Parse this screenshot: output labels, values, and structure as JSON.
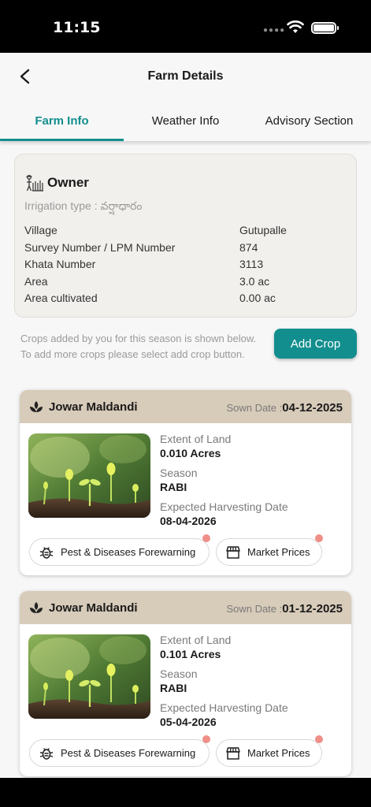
{
  "status_bar": {
    "time": "11:15"
  },
  "header": {
    "title": "Farm Details"
  },
  "tabs": [
    {
      "label": "Farm Info"
    },
    {
      "label": "Weather Info"
    },
    {
      "label": "Advisory Section"
    }
  ],
  "owner_card": {
    "name": "Owner",
    "irrigation_label": "Irrigation type :",
    "irrigation_value": "వర్షాధారం",
    "rows": [
      {
        "key": "Village",
        "value": "Gutupalle"
      },
      {
        "key": "Survey Number / LPM Number",
        "value": "874"
      },
      {
        "key": "Khata Number",
        "value": "3113"
      },
      {
        "key": "Area",
        "value": "3.0 ac"
      },
      {
        "key": "Area cultivated",
        "value": "0.00 ac"
      }
    ]
  },
  "note": "Crops added by you for this season is shown below. To add more crops please select add crop button.",
  "add_crop_label": "Add Crop",
  "colors": {
    "accent": "#128e8e",
    "card_header": "#d7cbb9",
    "dot": "#ef8f87"
  },
  "crops": [
    {
      "name": "Jowar Maldandi",
      "sown_label": "Sown Date :",
      "sown_date": "04-12-2025",
      "extent_label": "Extent of Land",
      "extent_value": "0.010 Acres",
      "season_label": "Season",
      "season_value": "RABI",
      "harvest_label": "Expected Harvesting Date",
      "harvest_value": "08-04-2026",
      "pest_label": "Pest & Diseases Forewarning",
      "market_label": "Market Prices"
    },
    {
      "name": "Jowar Maldandi",
      "sown_label": "Sown Date :",
      "sown_date": "01-12-2025",
      "extent_label": "Extent of Land",
      "extent_value": "0.101 Acres",
      "season_label": "Season",
      "season_value": "RABI",
      "harvest_label": "Expected Harvesting Date",
      "harvest_value": "05-04-2026",
      "pest_label": "Pest & Diseases Forewarning",
      "market_label": "Market Prices"
    }
  ]
}
